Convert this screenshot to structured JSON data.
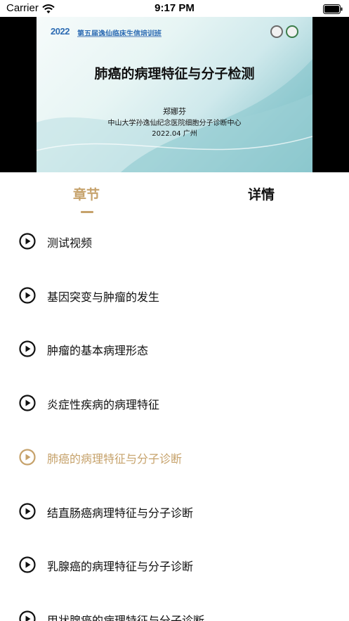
{
  "status_bar": {
    "carrier": "Carrier",
    "time": "9:17 PM"
  },
  "video": {
    "slide": {
      "logo_year": "2022",
      "brand": "第五届逸仙临床生信培训班",
      "title": "肺癌的病理特征与分子检测",
      "author": "郑娜芬",
      "organization": "中山大学孙逸仙纪念医院细胞分子诊断中心",
      "date_place": "2022.04 广州"
    }
  },
  "tabs": [
    {
      "label": "章节",
      "active": true
    },
    {
      "label": "详情",
      "active": false
    }
  ],
  "chapters": [
    {
      "label": "测试视频",
      "active": false
    },
    {
      "label": "基因突变与肿瘤的发生",
      "active": false
    },
    {
      "label": "肿瘤的基本病理形态",
      "active": false
    },
    {
      "label": "炎症性疾病的病理特征",
      "active": false
    },
    {
      "label": "肺癌的病理特征与分子诊断",
      "active": true
    },
    {
      "label": "结直肠癌病理特征与分子诊断",
      "active": false
    },
    {
      "label": "乳腺癌的病理特征与分子诊断",
      "active": false
    },
    {
      "label": "甲状腺癌的病理特征与分子诊断",
      "active": false
    }
  ],
  "colors": {
    "accent": "#c6a26b",
    "text": "#111111",
    "video_background": "#000000"
  },
  "icons": {
    "chapter_icon": "play-circle-icon",
    "wifi": "wifi-icon",
    "battery": "battery-icon"
  }
}
